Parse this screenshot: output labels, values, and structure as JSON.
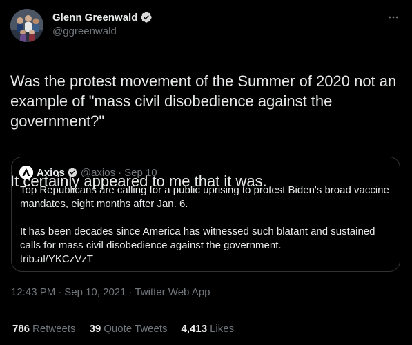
{
  "colors": {
    "background": "#000000",
    "text_primary": "#e7e9ea",
    "text_secondary": "#71767b",
    "border": "#2f3336",
    "verified_badge": "#d9d9d9"
  },
  "tweet": {
    "author": {
      "name": "Glenn Greenwald",
      "handle": "@ggreenwald",
      "verified_icon": "verified-badge-icon",
      "avatar_icon": "group-photo-avatar"
    },
    "more_icon": "more-horizontal-icon",
    "text": {
      "paragraph_1": "Was the protest movement of the Summer of 2020 not an example of \"mass civil disobedience against the government?\"",
      "paragraph_2": "It certainly appeared to me that it was."
    },
    "quote": {
      "name": "Axios",
      "handle": "@axios",
      "separator": "·",
      "date": "Sep 10",
      "avatar_icon": "axios-logo-icon",
      "verified_icon": "verified-badge-icon",
      "paragraph_1": "Top Republicans are calling for a public uprising to protest Biden's broad vaccine mandates, eight months after Jan. 6.",
      "paragraph_2": "It has been decades since America has witnessed such blatant and sustained calls for mass civil disobedience against the government.",
      "link": "trib.al/YKCzVzT"
    },
    "meta": {
      "time": "12:43 PM",
      "separator": "·",
      "date": "Sep 10, 2021",
      "source": "Twitter Web App"
    },
    "stats": {
      "retweets_count": "786",
      "retweets_label": "Retweets",
      "quotes_count": "39",
      "quotes_label": "Quote Tweets",
      "likes_count": "4,413",
      "likes_label": "Likes"
    }
  }
}
